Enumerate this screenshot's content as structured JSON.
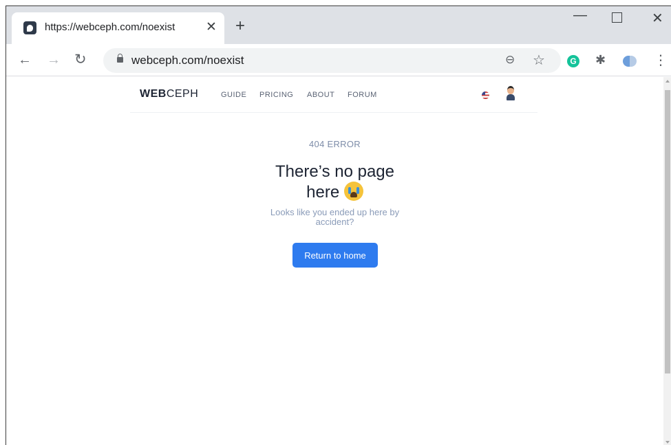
{
  "browser": {
    "tab": {
      "title": "https://webceph.com/noexist",
      "close": "✕"
    },
    "new_tab": "+",
    "window": {
      "minimize": "—",
      "close": "✕"
    },
    "toolbar": {
      "back": "←",
      "forward": "→",
      "reload": "↻",
      "url": "webceph.com/noexist",
      "zoom_icon": "⊖",
      "bookmark_icon": "☆",
      "grammarly_letter": "G",
      "extensions_icon": "✱",
      "menu_icon": "⋮"
    }
  },
  "site": {
    "logo": {
      "bold": "WEB",
      "light": "CEPH"
    },
    "nav": [
      "GUIDE",
      "PRICING",
      "ABOUT",
      "FORUM"
    ]
  },
  "page": {
    "error_code": "404 ERROR",
    "headline_line1": "There’s no page",
    "headline_line2": "here",
    "sub_line1": "Looks like you ended up here by",
    "sub_line2": "accident?",
    "button": "Return to home"
  },
  "colors": {
    "primary_button": "#2e7bef",
    "heading": "#1d2433",
    "muted_text": "#8a9bb8"
  }
}
